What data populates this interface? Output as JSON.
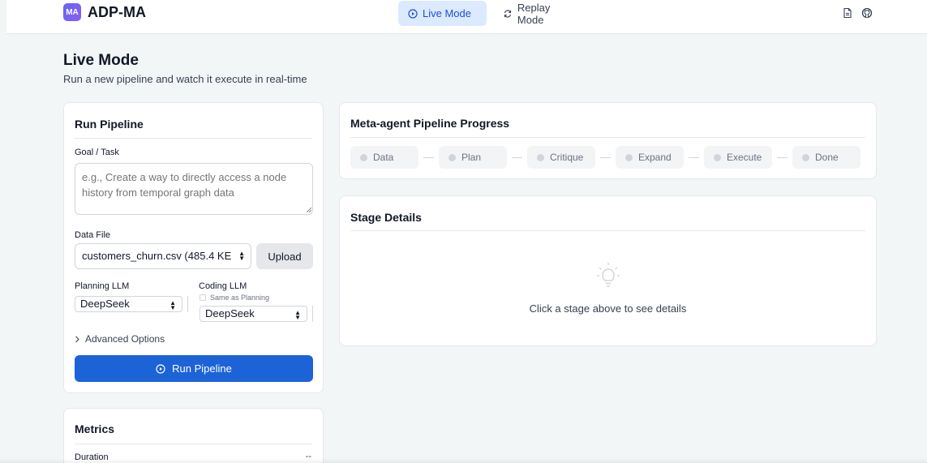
{
  "brand": {
    "badge": "MA",
    "name": "ADP-MA"
  },
  "nav": {
    "live_label": "Live Mode",
    "replay_label": "Replay Mode"
  },
  "page": {
    "title": "Live Mode",
    "subtitle": "Run a new pipeline and watch it execute in real-time"
  },
  "run_pipeline": {
    "title": "Run Pipeline",
    "goal_label": "Goal / Task",
    "goal_placeholder": "e.g., Create a way to directly access a node history from temporal graph data",
    "data_file_label": "Data File",
    "data_file_value": "customers_churn.csv (485.4 KE",
    "upload_label": "Upload",
    "planning_label": "Planning LLM",
    "planning_value": "DeepSeek",
    "coding_label": "Coding LLM",
    "same_as_planning_label": "Same as Planning",
    "coding_value": "DeepSeek",
    "advanced_label": "Advanced Options",
    "run_button_label": "Run Pipeline"
  },
  "metrics": {
    "title": "Metrics",
    "duration_label": "Duration",
    "duration_value": "--"
  },
  "progress": {
    "title": "Meta-agent Pipeline Progress",
    "steps": [
      "Data",
      "Plan",
      "Critique",
      "Expand",
      "Execute",
      "Done"
    ]
  },
  "stage_details": {
    "title": "Stage Details",
    "empty_text": "Click a stage above to see details"
  },
  "colors": {
    "accent": "#1d63d8",
    "active_tab_bg": "#dbeafe",
    "page_bg": "#f3f6f6"
  },
  "icons": {
    "live": "play-circle-icon",
    "replay": "refresh-icon",
    "doc": "document-icon",
    "github": "github-icon",
    "bulb": "lightbulb-icon"
  }
}
